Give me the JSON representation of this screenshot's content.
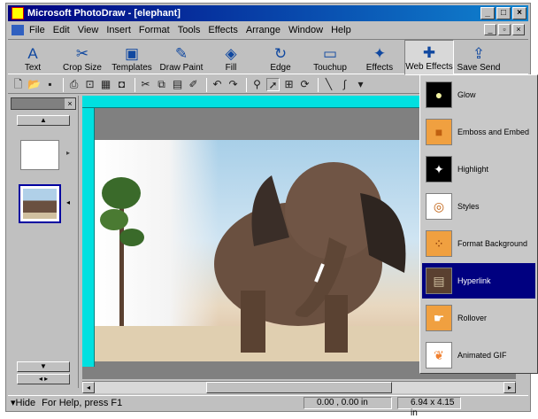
{
  "window": {
    "title": "Microsoft PhotoDraw - [elephant]"
  },
  "menu": [
    "File",
    "Edit",
    "View",
    "Insert",
    "Format",
    "Tools",
    "Effects",
    "Arrange",
    "Window",
    "Help"
  ],
  "big_toolbar": [
    {
      "label": "Text",
      "icon": "A"
    },
    {
      "label": "Crop Size",
      "icon": "✂"
    },
    {
      "label": "Templates",
      "icon": "▣"
    },
    {
      "label": "Draw Paint",
      "icon": "✎"
    },
    {
      "label": "Fill",
      "icon": "◈"
    },
    {
      "label": "Edge",
      "icon": "↻"
    },
    {
      "label": "Touchup",
      "icon": "▭"
    },
    {
      "label": "Effects",
      "icon": "✦"
    },
    {
      "label": "Web Effects",
      "icon": "✚"
    },
    {
      "label": "Save Send",
      "icon": "⇪"
    }
  ],
  "web_effects_menu": [
    {
      "label": "Glow",
      "icon_bg": "#000000",
      "icon_color": "#f0f0a0",
      "icon": "●"
    },
    {
      "label": "Emboss and Embed",
      "icon_bg": "#f0a040",
      "icon_color": "#c06010",
      "icon": "■"
    },
    {
      "label": "Highlight",
      "icon_bg": "#000000",
      "icon_color": "#ffffff",
      "icon": "✦"
    },
    {
      "label": "Styles",
      "icon_bg": "#ffffff",
      "icon_color": "#c06010",
      "icon": "◎"
    },
    {
      "label": "Format Background",
      "icon_bg": "#f0a040",
      "icon_color": "#803000",
      "icon": "⁘"
    },
    {
      "label": "Hyperlink",
      "icon_bg": "#5a4030",
      "icon_color": "#d0c0a0",
      "icon": "▤"
    },
    {
      "label": "Rollover",
      "icon_bg": "#f0a040",
      "icon_color": "#ffffff",
      "icon": "☛"
    },
    {
      "label": "Animated GIF",
      "icon_bg": "#ffffff",
      "icon_color": "#f08030",
      "icon": "❦"
    }
  ],
  "web_effects_selected": "Hyperlink",
  "status": {
    "hide": "Hide",
    "help": "For Help, press F1",
    "position": "0.00 , 0.00 in",
    "size": "6.94 x 4.15 in"
  }
}
